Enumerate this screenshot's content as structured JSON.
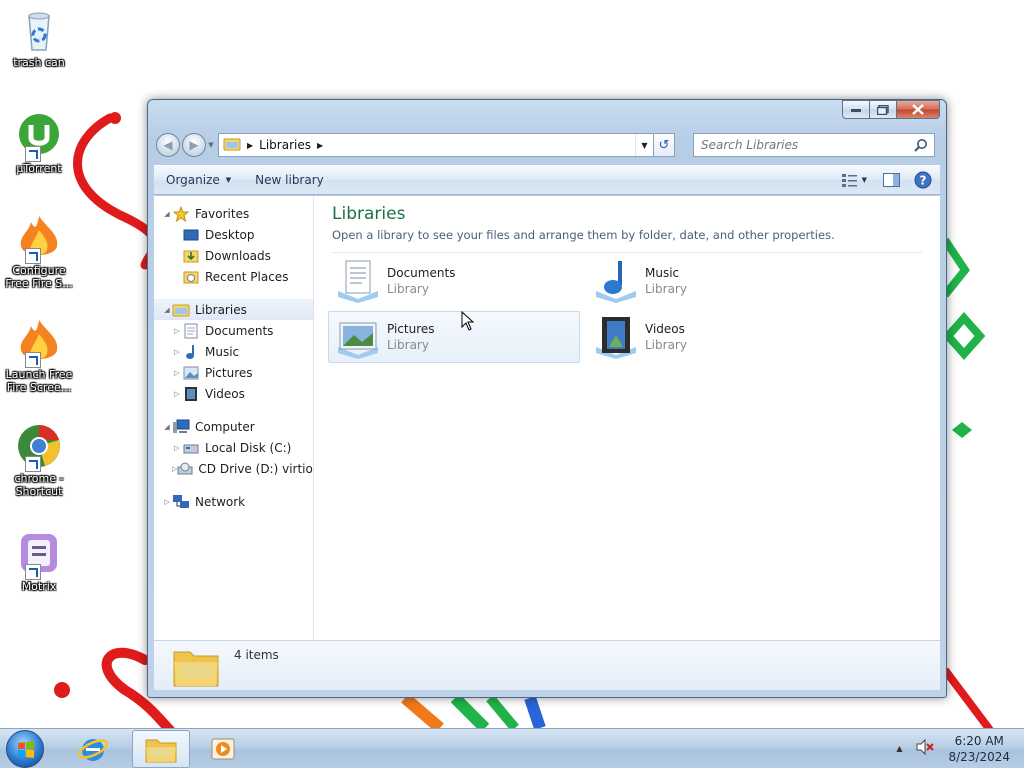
{
  "desktop": {
    "icons": [
      {
        "label": "trash can",
        "icon": "recycle-bin-icon"
      },
      {
        "label": "µTorrent",
        "icon": "utorrent-icon"
      },
      {
        "label": "Configure Free Fire S...",
        "icon": "fire-icon"
      },
      {
        "label": "Launch Free Fire Scree...",
        "icon": "fire-icon"
      },
      {
        "label": "chrome - Shortcut",
        "icon": "chrome-icon"
      },
      {
        "label": "Motrix",
        "icon": "motrix-icon"
      }
    ]
  },
  "window": {
    "address": {
      "crumb": "Libraries",
      "dropdown": "history-dropdown",
      "refresh": "refresh-icon"
    },
    "search": {
      "placeholder": "Search Libraries"
    },
    "toolbar": {
      "organize_label": "Organize",
      "new_library_label": "New library",
      "icons": [
        "view-options-icon",
        "preview-pane-icon",
        "help-icon"
      ]
    },
    "navpane": {
      "favorites": {
        "label": "Favorites",
        "items": [
          "Desktop",
          "Downloads",
          "Recent Places"
        ]
      },
      "libraries": {
        "label": "Libraries",
        "items": [
          "Documents",
          "Music",
          "Pictures",
          "Videos"
        ]
      },
      "computer": {
        "label": "Computer",
        "items": [
          "Local Disk (C:)",
          "CD Drive (D:) virtio-w"
        ]
      },
      "network": {
        "label": "Network"
      }
    },
    "main": {
      "title": "Libraries",
      "subtitle": "Open a library to see your files and arrange them by folder, date, and other properties.",
      "tiles": [
        {
          "name": "Documents",
          "type": "Library",
          "icon": "documents-library-icon"
        },
        {
          "name": "Music",
          "type": "Library",
          "icon": "music-library-icon"
        },
        {
          "name": "Pictures",
          "type": "Library",
          "icon": "pictures-library-icon"
        },
        {
          "name": "Videos",
          "type": "Library",
          "icon": "videos-library-icon"
        }
      ]
    },
    "details": {
      "count": "4 items"
    }
  },
  "taskbar": {
    "buttons": [
      "start-orb",
      "internet-explorer-icon",
      "windows-explorer-icon",
      "media-player-icon"
    ],
    "time": "6:20 AM",
    "date": "8/23/2024"
  },
  "colors": {
    "accent_title": "#1e7145",
    "subtitle": "#4c607a",
    "selection": "#dfe9f5"
  }
}
